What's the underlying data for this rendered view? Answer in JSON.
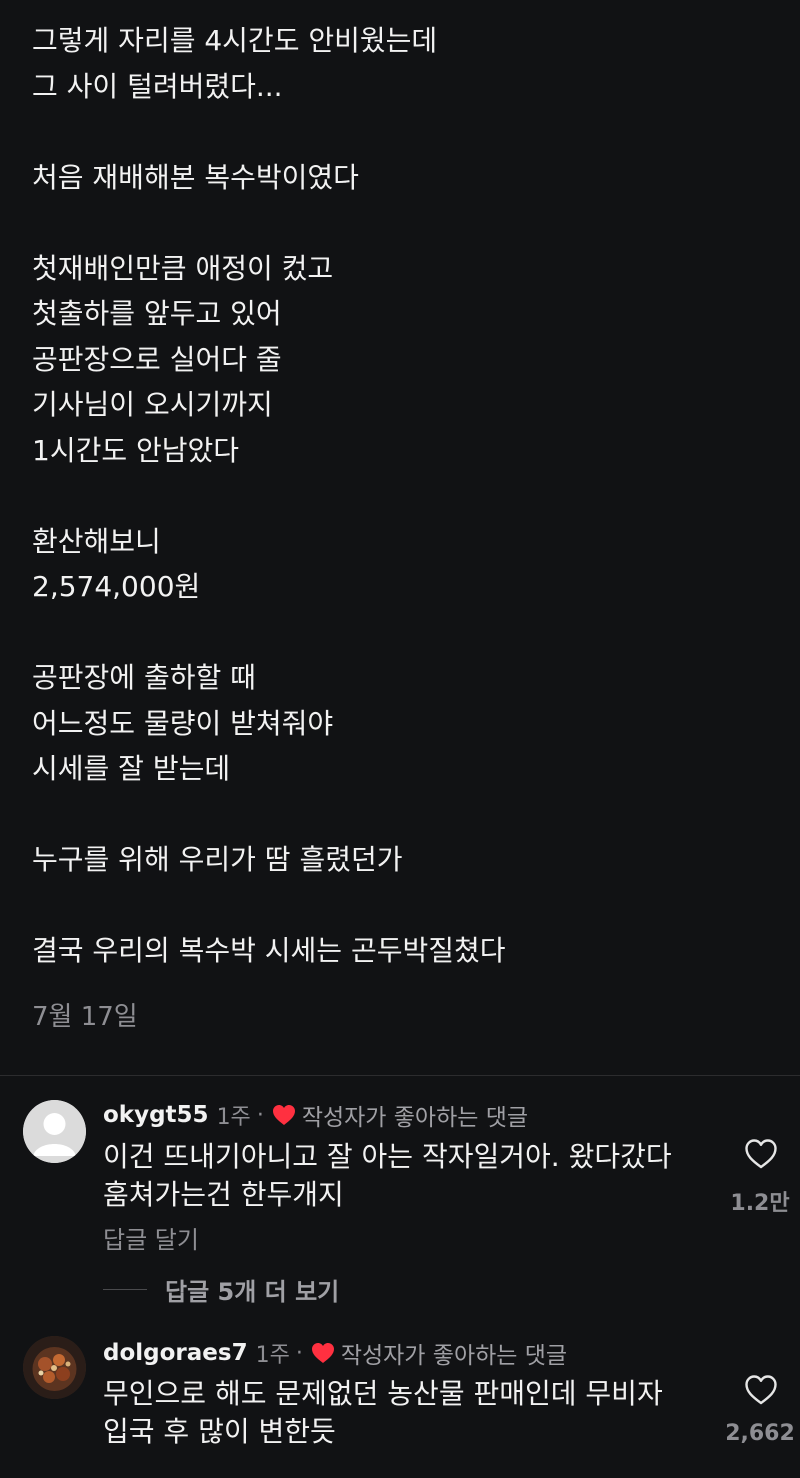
{
  "post": {
    "lines": [
      "그렇게 자리를 4시간도 안비웠는데",
      "그 사이 털려버렸다...",
      "",
      "처음 재배해본 복수박이였다",
      "",
      "첫재배인만큼 애정이 컸고",
      "첫출하를 앞두고 있어",
      "공판장으로 실어다 줄",
      "기사님이 오시기까지",
      "1시간도 안남았다",
      "",
      "환산해보니",
      "2,574,000원",
      "",
      "공판장에 출하할 때",
      "어느정도 물량이 받쳐줘야",
      "시세를 잘 받는데",
      "",
      "누구를 위해 우리가 땀 흘렸던가",
      "",
      "결국 우리의 복수박 시세는 곤두박질쳤다"
    ],
    "date": "7월 17일"
  },
  "comments": [
    {
      "username": "okygt55",
      "time": "1주",
      "separator": "·",
      "liked_by_author_label": "작성자가 좋아하는 댓글",
      "text_lines": [
        "이건 뜨내기아니고 잘 아는 작자일거아. 왔다갔다",
        "훔쳐가는건 한두개지"
      ],
      "reply_label": "답글 달기",
      "more_replies_label": "답글 5개 더 보기",
      "like_count": "1.2만",
      "avatar": "default-avatar-icon"
    },
    {
      "username": "dolgoraes7",
      "time": "1주",
      "separator": "·",
      "liked_by_author_label": "작성자가 좋아하는 댓글",
      "text_lines": [
        "무인으로 해도 문제없던 농산물 판매인데 무비자",
        "입국 후 많이 변한듯"
      ],
      "like_count": "2,662",
      "avatar": "food-photo-avatar"
    }
  ],
  "colors": {
    "background": "#111214",
    "text": "#f2f2f2",
    "muted": "#8e8e93",
    "heart_red": "#ff3040"
  }
}
